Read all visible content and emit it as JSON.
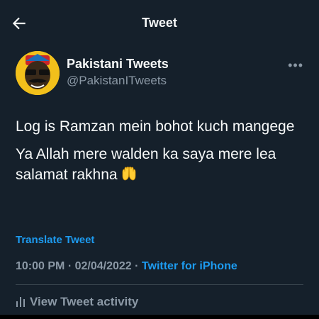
{
  "header": {
    "title": "Tweet"
  },
  "author": {
    "name": "Pakistani Tweets",
    "handle": "@PakistanITweets"
  },
  "tweet": {
    "line1": "Log is Ramzan mein bohot kuch mangege",
    "line2": "Ya Allah mere walden ka saya mere lea salamat rakhna",
    "emoji": "open-hands-emoji"
  },
  "translate_label": "Translate Tweet",
  "meta": {
    "time": "10:00 PM",
    "separator": "·",
    "date": "02/04/2022",
    "source": "Twitter for iPhone"
  },
  "activity_label": "View Tweet activity",
  "icons": {
    "back": "back-arrow-icon",
    "more": "more-options-icon",
    "activity": "bar-chart-icon"
  },
  "colors": {
    "background": "#15202b",
    "text": "#f7f9f9",
    "muted": "#8b98a5",
    "accent": "#1d9bf0"
  }
}
